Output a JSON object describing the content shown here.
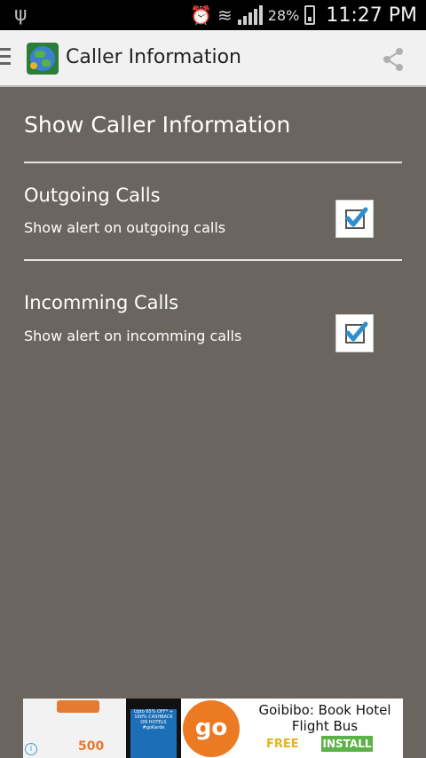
{
  "status_bar": {
    "battery": "28%",
    "time": "11:27 PM"
  },
  "app_bar": {
    "title": "Caller Information"
  },
  "settings": {
    "section_title": "Show Caller Information",
    "items": [
      {
        "title": "Outgoing Calls",
        "subtitle": "Show alert on outgoing calls",
        "checked": true
      },
      {
        "title": "Incomming Calls",
        "subtitle": "Show alert on incomming calls",
        "checked": true
      }
    ]
  },
  "ad": {
    "title": "Goibibo: Book Hotel Flight Bus",
    "free_label": "FREE",
    "install_label": "INSTALL",
    "logo_text": "go",
    "amount": "500",
    "promo_text": "Upto 65% OFF* + 100% CASHBACK ON HOTELS #goKarde"
  },
  "colors": {
    "background": "#6b6560",
    "checkmark": "#2e8fcf",
    "ad_orange": "#ec7a22",
    "install_green": "#5bb247"
  }
}
